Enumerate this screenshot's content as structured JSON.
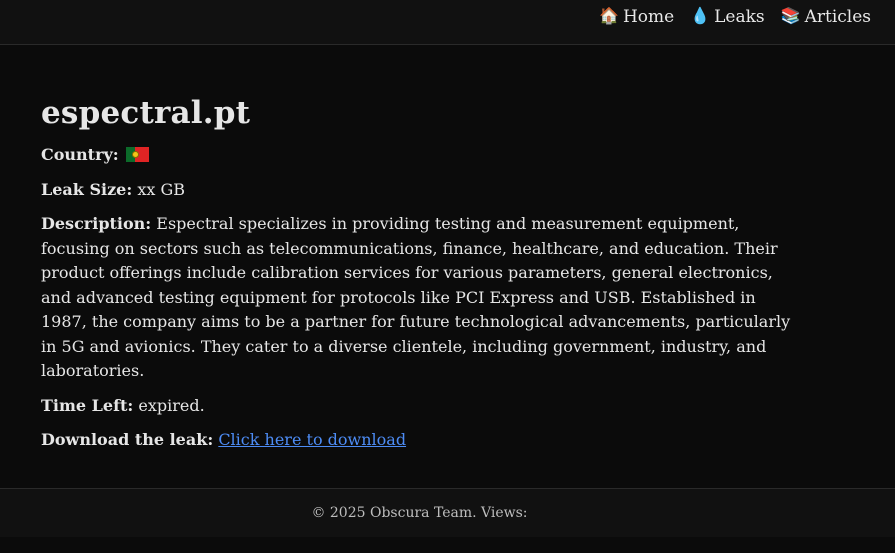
{
  "nav": {
    "items": [
      {
        "icon": "house-icon",
        "emoji": "🏠",
        "label": "Home"
      },
      {
        "icon": "droplet-icon",
        "emoji": "💧",
        "label": "Leaks"
      },
      {
        "icon": "books-icon",
        "emoji": "📚",
        "label": "Articles"
      }
    ]
  },
  "page": {
    "title": "espectral.pt",
    "country_label": "Country:",
    "country_flag": "portugal-flag-icon",
    "leak_size_label": "Leak Size:",
    "leak_size_value": "xx GB",
    "description_label": "Description:",
    "description_text": "Espectral specializes in providing testing and measurement equipment, focusing on sectors such as telecommunications, finance, healthcare, and education. Their product offerings include calibration services for various parameters, general electronics, and advanced testing equipment for protocols like PCI Express and USB. Established in 1987, the company aims to be a partner for future technological advancements, particularly in 5G and avionics. They cater to a diverse clientele, including government, industry, and laboratories.",
    "time_left_label": "Time Left:",
    "time_left_value": "expired.",
    "download_label": "Download the leak:",
    "download_link_text": "Click here to download"
  },
  "footer": {
    "text": "© 2025 Obscura Team. Views:"
  },
  "colors": {
    "background": "#0b0b0b",
    "bar": "#111111",
    "text": "#e6e6e6",
    "link": "#4d8cf5"
  }
}
